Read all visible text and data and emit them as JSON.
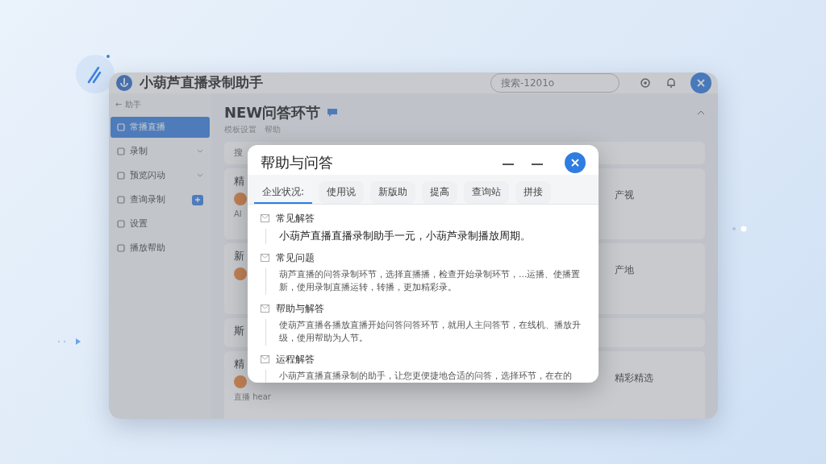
{
  "window": {
    "title": "小葫芦直播录制助手",
    "search": {
      "placeholder": "搜索-1201o"
    }
  },
  "sidebar": {
    "back": "← 助手",
    "items": [
      {
        "label": "常播直播",
        "selected": true,
        "kind": "plain"
      },
      {
        "label": "录制",
        "selected": false,
        "kind": "chevron"
      },
      {
        "label": "预览闪动",
        "selected": false,
        "kind": "chevron"
      },
      {
        "label": "查询录制",
        "selected": false,
        "kind": "badge"
      },
      {
        "label": "设置",
        "selected": false,
        "kind": "plain"
      },
      {
        "label": "播放帮助",
        "selected": false,
        "kind": "plain"
      }
    ]
  },
  "content": {
    "title": "NEW问答环节",
    "subtitle": "模板设置　帮助",
    "search_label": "搜",
    "cards": [
      {
        "title": "精",
        "note": "AI",
        "side": "产视",
        "avatar": true
      },
      {
        "title": "新",
        "side": "产地",
        "avatar": true
      },
      {
        "title": "斯",
        "avatar": false
      },
      {
        "title": "精",
        "note": "直播 hear",
        "side": "精彩精选",
        "avatar": true
      }
    ]
  },
  "dialog": {
    "title": "帮助与问答",
    "tabs": [
      {
        "label": "企业状况:",
        "selected": true
      },
      {
        "label": "使用说",
        "selected": false
      },
      {
        "label": "新版助",
        "selected": false
      },
      {
        "label": "提高",
        "selected": false
      },
      {
        "label": "查询站",
        "selected": false
      },
      {
        "label": "拼接",
        "selected": false
      }
    ],
    "sections": [
      {
        "heading": "常见解答",
        "text": "小葫芦直播直播录制助手一元，小葫芦录制播放周期。",
        "strong": true
      },
      {
        "heading": "常见问题",
        "text": "葫芦直播的问答录制环节，选择直播播，检查开始录制环节，...运播、使播置新，使用录制直播运转，转播，更加精彩录。",
        "strong": false
      },
      {
        "heading": "帮助与解答",
        "text": "使葫芦直播各播放直播开始问答问答环节，就用人主问答节，在线机、播放升级，使用帮助为人节。",
        "strong": false
      },
      {
        "heading": "运程解答",
        "text": "小葫芦直播直播录制的助手，让您更便捷地合适的问答，选择环节，在在的",
        "strong": false
      }
    ]
  }
}
